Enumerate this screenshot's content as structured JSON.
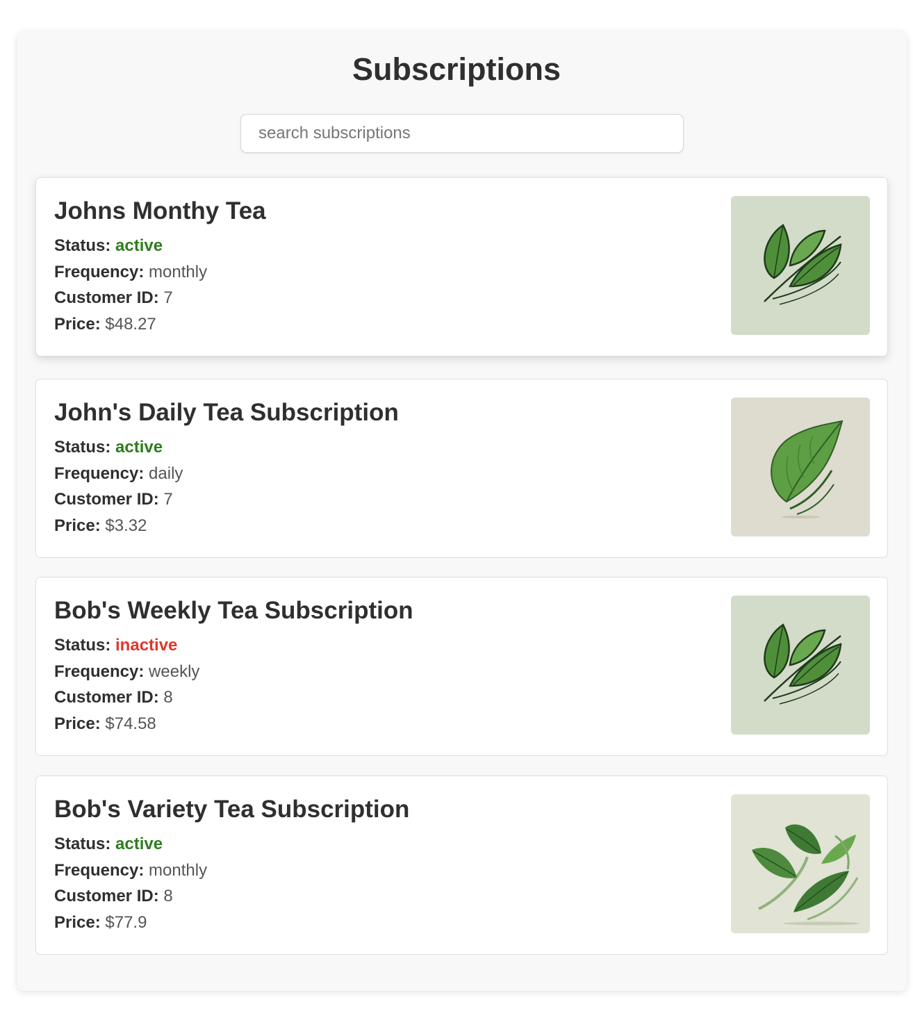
{
  "page": {
    "title": "Subscriptions",
    "search_placeholder": "search subscriptions"
  },
  "labels": {
    "status": "Status:",
    "frequency": "Frequency:",
    "customer_id": "Customer ID:",
    "price": "Price:"
  },
  "colors": {
    "active": "#2e7d1e",
    "inactive": "#e0362b"
  },
  "subscriptions": [
    {
      "name": "Johns Monthy Tea",
      "status": "active",
      "frequency": "monthly",
      "customer_id": "7",
      "price": "$48.27",
      "image_icon": "twin-tea-leaves-icon"
    },
    {
      "name": "John's Daily Tea Subscription",
      "status": "active",
      "frequency": "daily",
      "customer_id": "7",
      "price": "$3.32",
      "image_icon": "single-tea-leaf-icon"
    },
    {
      "name": "Bob's Weekly Tea Subscription",
      "status": "inactive",
      "frequency": "weekly",
      "customer_id": "8",
      "price": "$74.58",
      "image_icon": "twin-tea-leaves-icon"
    },
    {
      "name": "Bob's Variety Tea Subscription",
      "status": "active",
      "frequency": "monthly",
      "customer_id": "8",
      "price": "$77.9",
      "image_icon": "tea-leaf-cluster-icon"
    }
  ]
}
